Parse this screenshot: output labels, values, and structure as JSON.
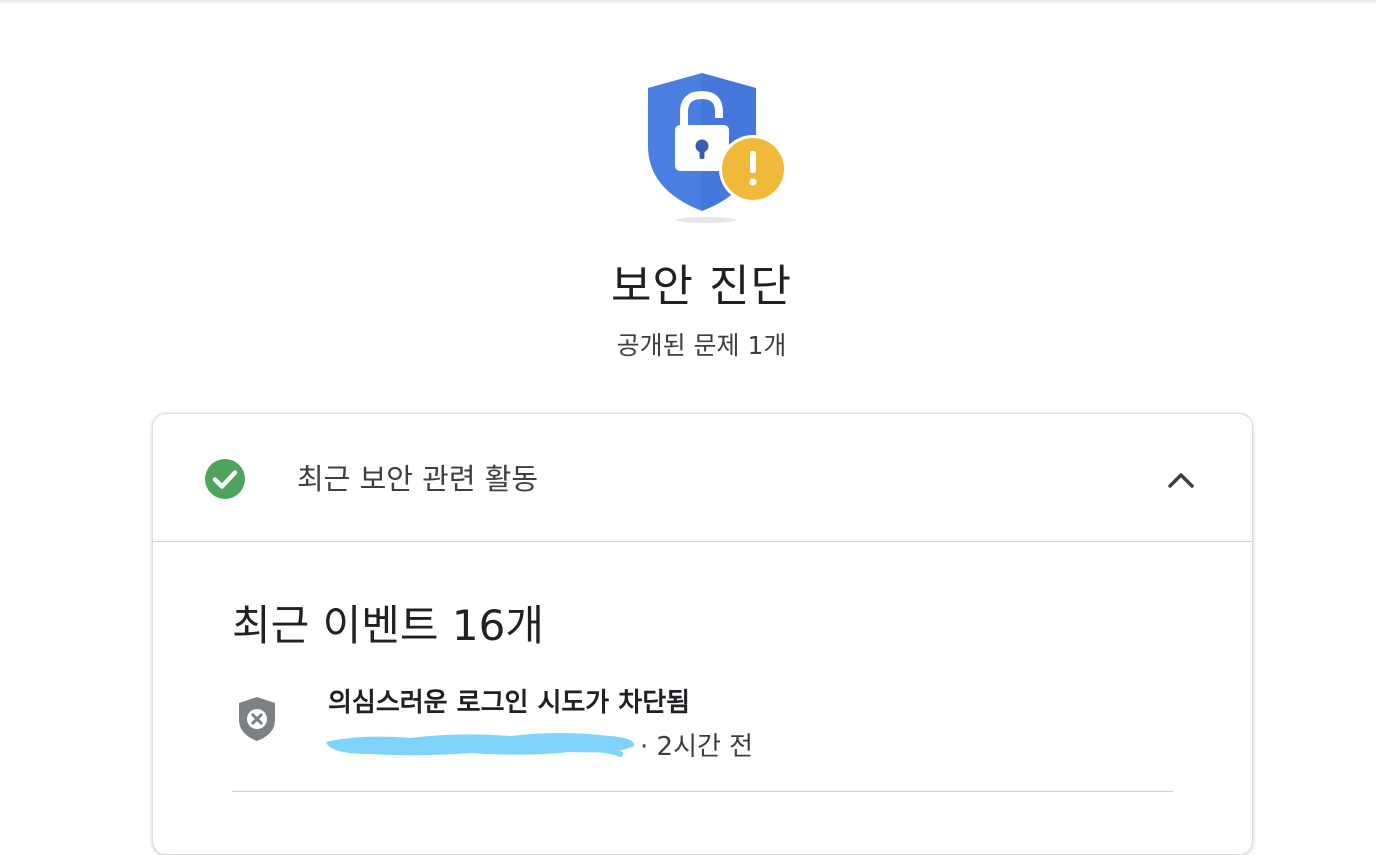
{
  "hero": {
    "icon": "shield-lock-warning-icon",
    "title": "보안 진단",
    "subtitle": "공개된 문제 1개"
  },
  "card": {
    "header": {
      "icon": "check-circle-icon",
      "label": "최근 보안 관련 활동",
      "toggle_icon": "chevron-up-icon",
      "expanded": true
    },
    "events_title": "최근 이벤트 16개",
    "events": [
      {
        "icon": "shield-x-icon",
        "title": "의심스러운 로그인 시도가 차단됨",
        "time": "· 2시간 전"
      }
    ]
  },
  "colors": {
    "shield_blue": "#4a7ee0",
    "warning_yellow": "#f0b93a",
    "check_green": "#4ea45c",
    "blocked_gray": "#7d8184",
    "redaction_blue": "#80d4fb"
  }
}
